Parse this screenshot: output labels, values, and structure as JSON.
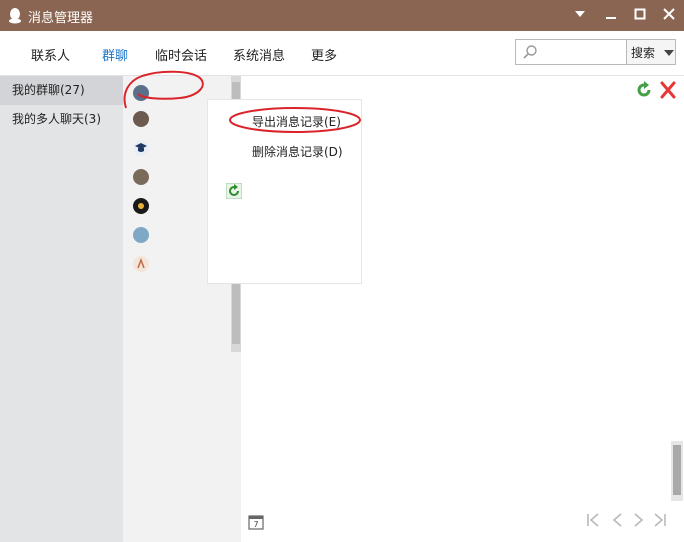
{
  "window": {
    "title": "消息管理器",
    "minimize_glyph": "▼",
    "restore_glyph": "▬",
    "maximize_glyph": "☐",
    "close_glyph": "✕"
  },
  "tabs": [
    {
      "label": "联系人",
      "active": false
    },
    {
      "label": "群聊",
      "active": true
    },
    {
      "label": "临时会话",
      "active": false
    },
    {
      "label": "系统消息",
      "active": false
    },
    {
      "label": "更多",
      "active": false
    }
  ],
  "search": {
    "placeholder": "",
    "value": "",
    "button_label": "搜索"
  },
  "sidebar": {
    "items": [
      {
        "label": "我的群聊(27)",
        "selected": true
      },
      {
        "label": "我的多人聊天(3)",
        "selected": false
      }
    ]
  },
  "group_list": {
    "avatars": [
      {
        "icon": "group-avatar-icon",
        "color": "#5a6f8a"
      },
      {
        "icon": "group-avatar-icon",
        "color": "#6d5a4e"
      },
      {
        "icon": "graduation-cap-icon",
        "color": "#1f3b63"
      },
      {
        "icon": "group-avatar-icon",
        "color": "#7a6a5a"
      },
      {
        "icon": "group-avatar-icon",
        "color": "#1a1a1a"
      },
      {
        "icon": "group-avatar-icon",
        "color": "#7fa7c6"
      },
      {
        "icon": "group-avatar-icon",
        "color": "#d9b38c"
      }
    ]
  },
  "context_menu": {
    "items": [
      {
        "label": "导出消息记录(E)"
      },
      {
        "label": "删除消息记录(D)"
      }
    ]
  },
  "colors": {
    "titlebar": "#8a6652",
    "active_tab": "#1e76c8",
    "annotation": "#d9252a",
    "refresh": "#43a047",
    "delete": "#e53935"
  },
  "nav_glyphs": {
    "first": "|<",
    "prev": "<",
    "next": ">",
    "last": ">|"
  }
}
